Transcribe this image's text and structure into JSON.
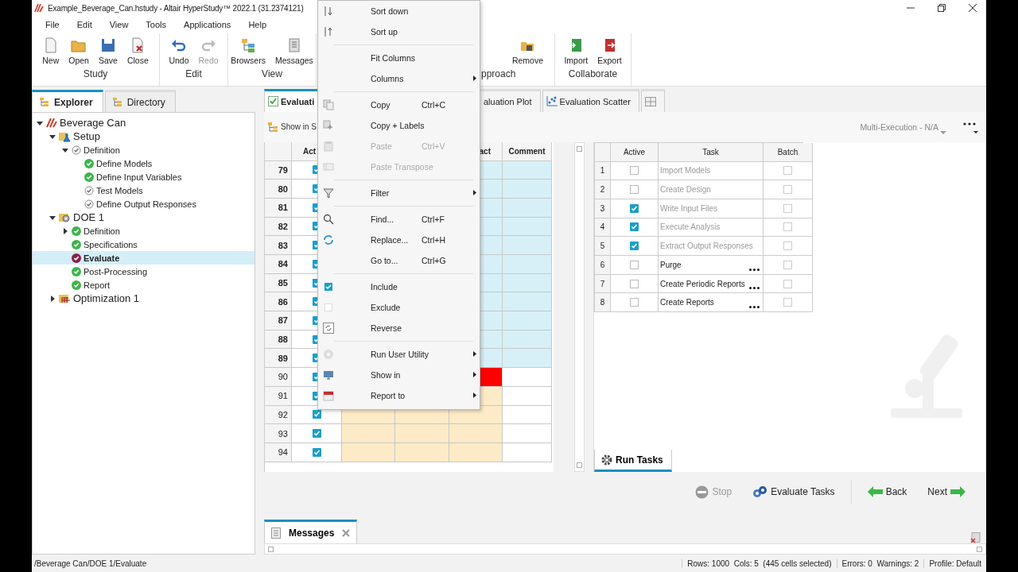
{
  "window": {
    "title": "Example_Beverage_Can.hstudy - Altair HyperStudy™ 2022.1 (31.2374121)"
  },
  "menu_bar": [
    "File",
    "Edit",
    "View",
    "Tools",
    "Applications",
    "Help"
  ],
  "ribbon": [
    {
      "label": "Study",
      "buttons": [
        {
          "label": "New",
          "disabled": false
        },
        {
          "label": "Open",
          "disabled": false
        },
        {
          "label": "Save",
          "disabled": false
        },
        {
          "label": "Close",
          "disabled": false
        }
      ]
    },
    {
      "label": "Edit",
      "buttons": [
        {
          "label": "Undo",
          "disabled": false
        },
        {
          "label": "Redo",
          "disabled": true
        }
      ]
    },
    {
      "label": "View",
      "buttons": [
        {
          "label": "Browsers",
          "disabled": false
        },
        {
          "label": "Messages",
          "disabled": false
        }
      ]
    },
    {
      "label": "pproach",
      "buttons": [
        {
          "label": "Remove",
          "disabled": false
        }
      ]
    },
    {
      "label": "Collaborate",
      "buttons": [
        {
          "label": "Import",
          "disabled": false
        },
        {
          "label": "Export",
          "disabled": false
        }
      ]
    }
  ],
  "explorer": {
    "tabs": [
      {
        "label": "Explorer",
        "selected": true
      },
      {
        "label": "Directory",
        "selected": false
      }
    ],
    "tree": [
      {
        "label": "Beverage Can",
        "kind": "study",
        "expanded": true,
        "selected": false,
        "children": [
          {
            "label": "Setup",
            "kind": "setup",
            "expanded": true,
            "selected": false,
            "children": [
              {
                "label": "Definition",
                "kind": "step",
                "complete": false,
                "expanded": true,
                "selected": false,
                "children": [
                  {
                    "label": "Define Models",
                    "kind": "step",
                    "complete": true,
                    "selected": false
                  },
                  {
                    "label": "Define Input Variables",
                    "kind": "step",
                    "complete": true,
                    "selected": false
                  },
                  {
                    "label": "Test Models",
                    "kind": "step",
                    "complete": false,
                    "selected": false
                  },
                  {
                    "label": "Define Output Responses",
                    "kind": "step",
                    "complete": false,
                    "selected": false
                  }
                ]
              }
            ]
          },
          {
            "label": "DOE 1",
            "kind": "doe",
            "expanded": true,
            "selected": false,
            "children": [
              {
                "label": "Definition",
                "kind": "step",
                "complete": true,
                "expanded": false,
                "selected": false
              },
              {
                "label": "Specifications",
                "kind": "step",
                "complete": true,
                "selected": false
              },
              {
                "label": "Evaluate",
                "kind": "step",
                "complete": false,
                "selected": true
              },
              {
                "label": "Post-Processing",
                "kind": "step",
                "complete": true,
                "selected": false
              },
              {
                "label": "Report",
                "kind": "step",
                "complete": true,
                "selected": false
              }
            ]
          },
          {
            "label": "Optimization 1",
            "kind": "optimization",
            "expanded": false,
            "selected": false
          }
        ]
      }
    ]
  },
  "main_tabs": [
    {
      "label": "Evaluati",
      "selected": true
    },
    {
      "label": "aluation Plot",
      "selected": false
    },
    {
      "label": "Evaluation Scatter",
      "selected": false
    },
    {
      "kind": "icon",
      "selected": false
    }
  ],
  "toolbar": {
    "show_in": "Show in S",
    "execution": "Multi-Execution - N/A"
  },
  "grid": {
    "headers": {
      "active": "Act",
      "column_5": "act",
      "comment": "Comment"
    },
    "rows": [
      {
        "number": "79",
        "active": true,
        "selected": true,
        "failed": false
      },
      {
        "number": "80",
        "active": true,
        "selected": true,
        "failed": false
      },
      {
        "number": "81",
        "active": true,
        "selected": true,
        "failed": false
      },
      {
        "number": "82",
        "active": true,
        "selected": true,
        "failed": false
      },
      {
        "number": "83",
        "active": true,
        "selected": true,
        "failed": false
      },
      {
        "number": "84",
        "active": true,
        "selected": true,
        "failed": false
      },
      {
        "number": "85",
        "active": true,
        "selected": true,
        "failed": false
      },
      {
        "number": "86",
        "active": true,
        "selected": true,
        "failed": false
      },
      {
        "number": "87",
        "active": true,
        "selected": true,
        "failed": false
      },
      {
        "number": "88",
        "active": true,
        "selected": true,
        "failed": false
      },
      {
        "number": "89",
        "active": true,
        "selected": true,
        "failed": false
      },
      {
        "number": "90",
        "active": true,
        "selected": false,
        "failed": true
      },
      {
        "number": "91",
        "active": true,
        "selected": false,
        "failed": false
      },
      {
        "number": "92",
        "active": true,
        "selected": false,
        "failed": false
      },
      {
        "number": "93",
        "active": true,
        "selected": false,
        "failed": false
      },
      {
        "number": "94",
        "active": true,
        "selected": false,
        "failed": false
      }
    ]
  },
  "tasks": {
    "columns": [
      "Active",
      "Task",
      "Batch"
    ],
    "rows": [
      {
        "number": "1",
        "active": false,
        "task": "Import Models",
        "disabled": true,
        "options": false,
        "batch": false
      },
      {
        "number": "2",
        "active": false,
        "task": "Create Design",
        "disabled": true,
        "options": false,
        "batch": false
      },
      {
        "number": "3",
        "active": true,
        "task": "Write Input Files",
        "disabled": true,
        "options": false,
        "batch": false
      },
      {
        "number": "4",
        "active": true,
        "task": "Execute Analysis",
        "disabled": true,
        "options": false,
        "batch": false
      },
      {
        "number": "5",
        "active": true,
        "task": "Extract Output Responses",
        "disabled": true,
        "options": false,
        "batch": false
      },
      {
        "number": "6",
        "active": false,
        "task": "Purge",
        "disabled": false,
        "options": true,
        "batch": false
      },
      {
        "number": "7",
        "active": false,
        "task": "Create Periodic Reports",
        "disabled": false,
        "options": true,
        "batch": false
      },
      {
        "number": "8",
        "active": false,
        "task": "Create Reports",
        "disabled": false,
        "options": true,
        "batch": false
      }
    ]
  },
  "run_tasks_tab": {
    "label": "Run Tasks",
    "selected": true
  },
  "actions": [
    {
      "label": "Stop",
      "disabled": true
    },
    {
      "label": "Evaluate Tasks",
      "disabled": false
    },
    {
      "label": "Back",
      "disabled": false
    },
    {
      "label": "Next",
      "disabled": false
    }
  ],
  "messages_tab": {
    "label": "Messages",
    "selected": true
  },
  "status_bar": {
    "path": "/Beverage Can/DOE 1/Evaluate",
    "counts": "Rows: 1000  Cols: 5  (445 cells selected)",
    "problems": "Errors: 0  Warnings: 2",
    "profile": "Profile: Default"
  },
  "context_menu": {
    "sections": [
      [
        {
          "label": "Sort down",
          "disabled": false,
          "submenu": false
        },
        {
          "label": "Sort up",
          "disabled": false,
          "submenu": false
        }
      ],
      [
        {
          "label": "Fit Columns",
          "disabled": false,
          "submenu": false
        },
        {
          "label": "Columns",
          "disabled": false,
          "submenu": true
        }
      ],
      [
        {
          "label": "Copy",
          "shortcut": "Ctrl+C",
          "disabled": false,
          "submenu": false
        },
        {
          "label": "Copy + Labels",
          "disabled": false,
          "submenu": false
        },
        {
          "label": "Paste",
          "shortcut": "Ctrl+V",
          "disabled": true,
          "submenu": false
        },
        {
          "label": "Paste Transpose",
          "disabled": true,
          "submenu": false
        }
      ],
      [
        {
          "label": "Filter",
          "disabled": false,
          "submenu": true
        }
      ],
      [
        {
          "label": "Find...",
          "shortcut": "Ctrl+F",
          "disabled": false,
          "submenu": false
        },
        {
          "label": "Replace...",
          "shortcut": "Ctrl+H",
          "disabled": false,
          "submenu": false
        },
        {
          "label": "Go to...",
          "shortcut": "Ctrl+G",
          "disabled": false,
          "submenu": false
        }
      ],
      [
        {
          "label": "Include",
          "disabled": false,
          "submenu": false
        },
        {
          "label": "Exclude",
          "disabled": false,
          "submenu": false
        },
        {
          "label": "Reverse",
          "disabled": false,
          "submenu": false
        }
      ],
      [
        {
          "label": "Run User Utility",
          "disabled": false,
          "submenu": true
        },
        {
          "label": "Show in",
          "disabled": false,
          "submenu": true
        },
        {
          "label": "Report to",
          "disabled": false,
          "submenu": true
        }
      ]
    ]
  }
}
